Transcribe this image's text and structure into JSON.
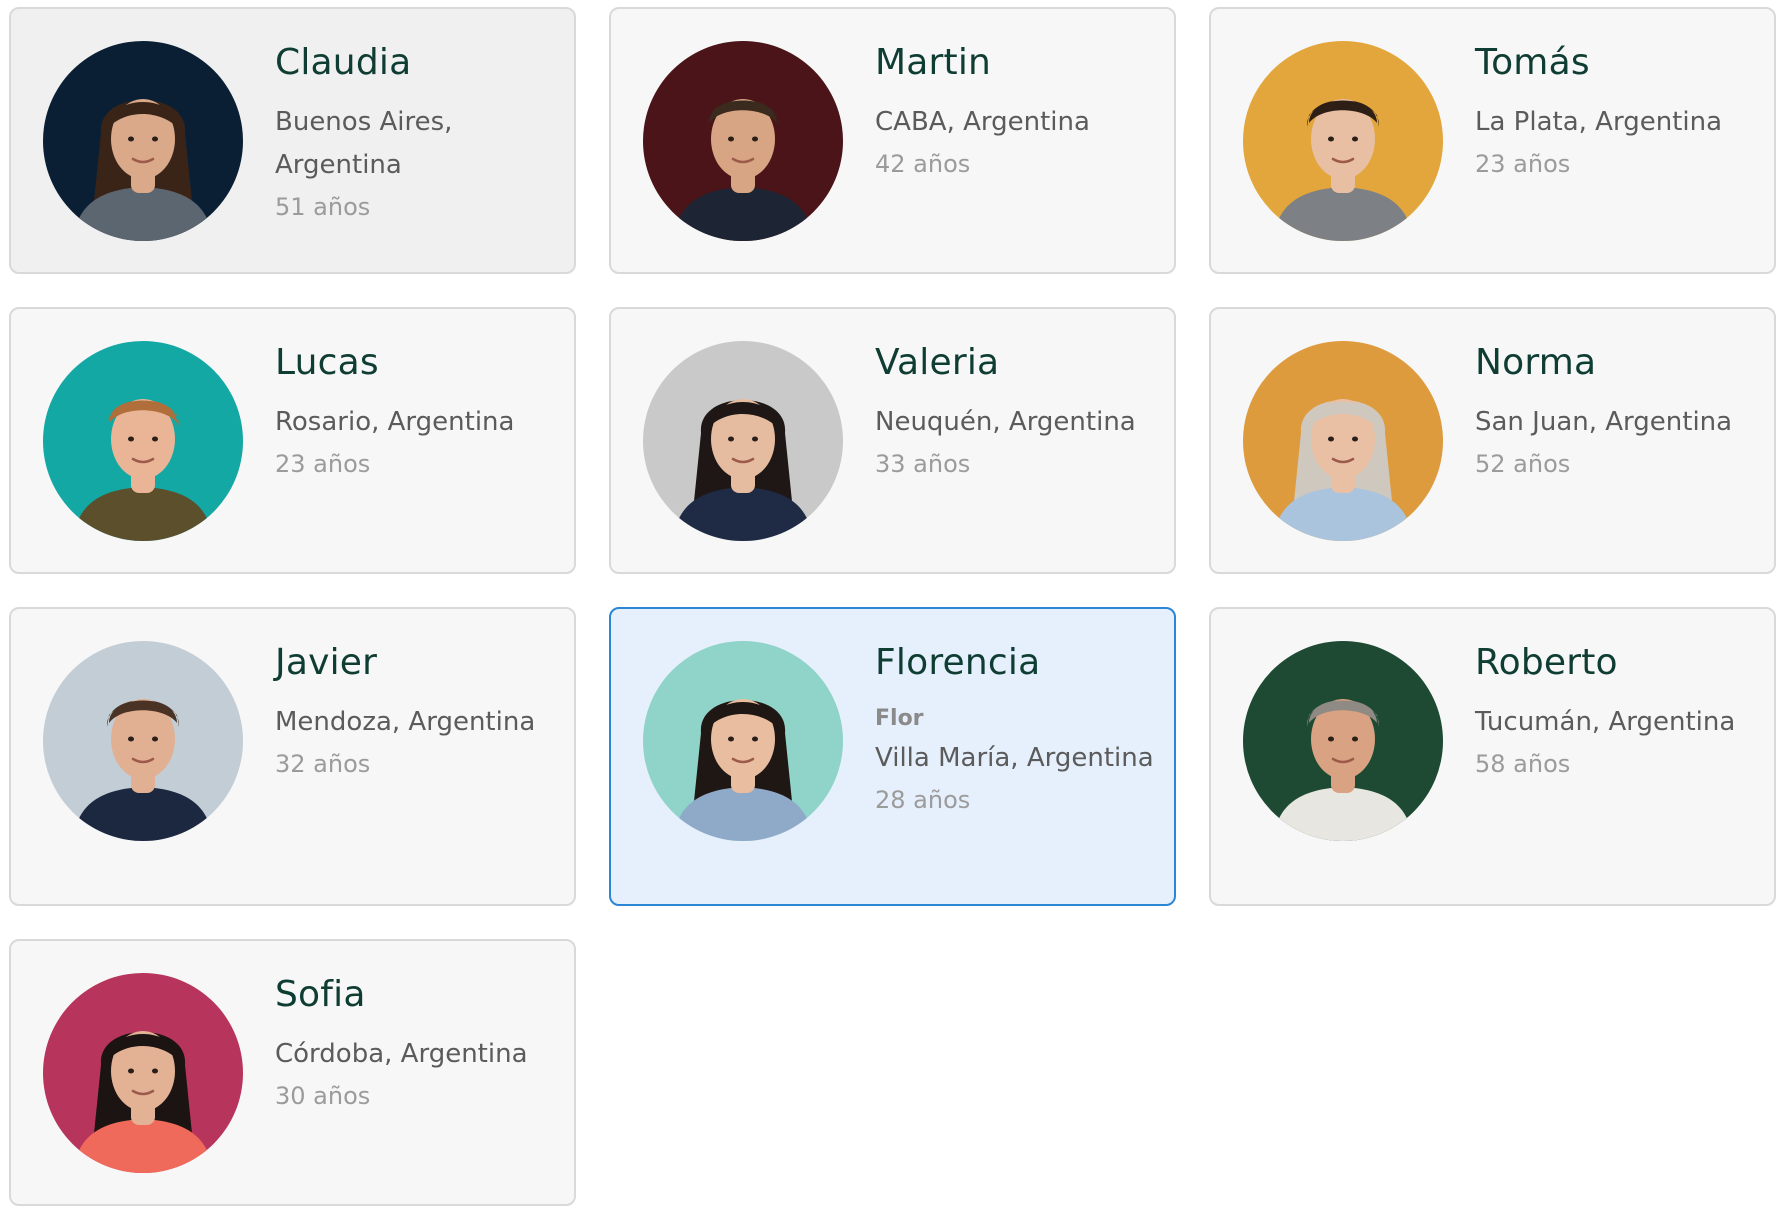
{
  "profiles": [
    {
      "name": "Claudia",
      "location": "Buenos Aires, Argentina",
      "age": "51 años",
      "bg_color": "#0a1f33",
      "skin_color": "#d9a98a",
      "hair_color": "#3a2418",
      "outfit_color": "#5c6670",
      "icon": "woman-portrait-icon",
      "state": "hovered"
    },
    {
      "name": "Martin",
      "location": "CABA, Argentina",
      "age": "42 años",
      "bg_color": "#4a1418",
      "skin_color": "#d8a584",
      "hair_color": "#3b2a1e",
      "outfit_color": "#1d2433",
      "icon": "man-glasses-portrait-icon"
    },
    {
      "name": "Tomás",
      "location": "La Plata, Argentina",
      "age": "23 años",
      "bg_color": "#e3a63c",
      "skin_color": "#e8bfa2",
      "hair_color": "#2d1f16",
      "outfit_color": "#7d8085",
      "icon": "man-glasses-portrait-icon"
    },
    {
      "name": "Lucas",
      "location": "Rosario, Argentina",
      "age": "23 años",
      "bg_color": "#13a8a3",
      "skin_color": "#e9b596",
      "hair_color": "#b06e3a",
      "outfit_color": "#5b4f2c",
      "icon": "man-portrait-icon"
    },
    {
      "name": "Valeria",
      "location": "Neuquén, Argentina",
      "age": "33 años",
      "bg_color": "#c9c9c9",
      "skin_color": "#e6bca0",
      "hair_color": "#1e1715",
      "outfit_color": "#1f2a44",
      "icon": "woman-portrait-icon"
    },
    {
      "name": "Norma",
      "location": "San Juan, Argentina",
      "age": "52 años",
      "bg_color": "#dd9b3e",
      "skin_color": "#eac0a4",
      "hair_color": "#cfc8be",
      "outfit_color": "#a9c4dc",
      "icon": "woman-portrait-icon"
    },
    {
      "name": "Javier",
      "location": "Mendoza, Argentina",
      "age": "32 años",
      "bg_color": "#c2cdd6",
      "skin_color": "#e1b092",
      "hair_color": "#4a3324",
      "outfit_color": "#1c2840",
      "icon": "man-portrait-icon"
    },
    {
      "name": "Florencia",
      "nickname": "Flor",
      "location": "Villa María, Argentina",
      "age": "28 años",
      "bg_color": "#8fd3c9",
      "skin_color": "#e9bd9f",
      "hair_color": "#1f1714",
      "outfit_color": "#8fa9c8",
      "icon": "woman-portrait-icon",
      "state": "selected"
    },
    {
      "name": "Roberto",
      "location": "Tucumán, Argentina",
      "age": "58 años",
      "bg_color": "#1e4a33",
      "skin_color": "#d9a283",
      "hair_color": "#8f8a84",
      "outfit_color": "#e8e6e1",
      "icon": "man-portrait-icon"
    },
    {
      "name": "Sofia",
      "location": "Córdoba, Argentina",
      "age": "30 años",
      "bg_color": "#b7345d",
      "skin_color": "#e3b295",
      "hair_color": "#1c1412",
      "outfit_color": "#ef6a5a",
      "icon": "woman-portrait-icon"
    }
  ]
}
